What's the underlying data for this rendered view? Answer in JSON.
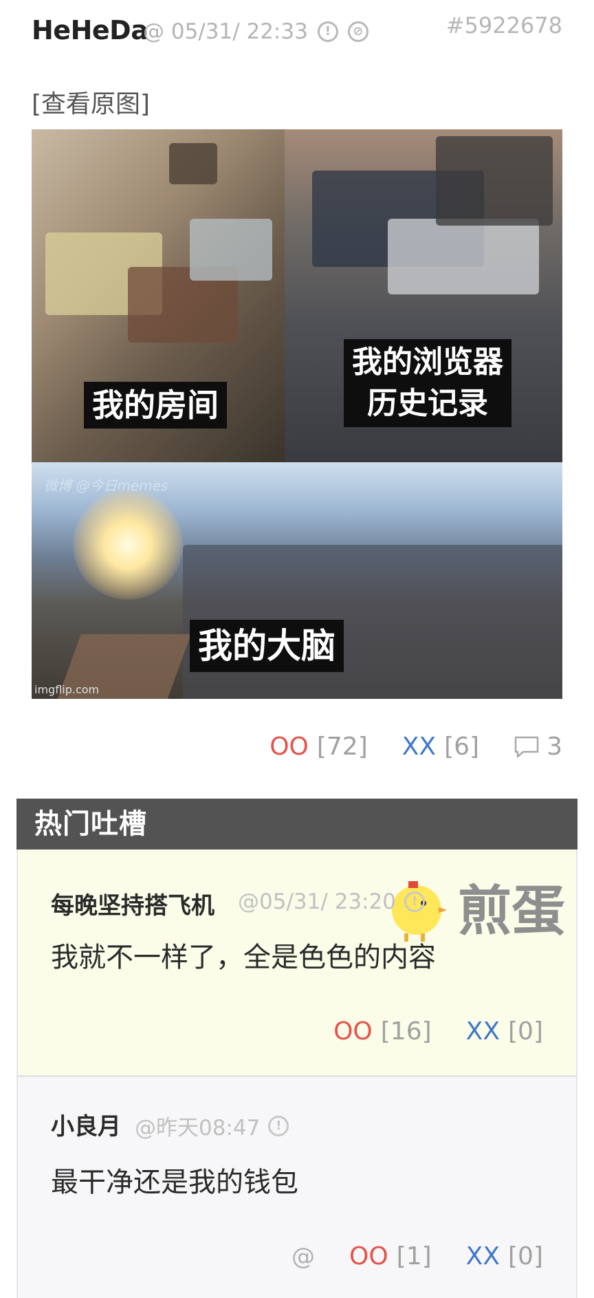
{
  "post": {
    "author": "HeHeDa",
    "meta": "@ 05/31/ 22:33",
    "id": "#5922678",
    "view_original": "[查看原图]",
    "image": {
      "captions": [
        "我的房间",
        "我的浏览器\n历史记录",
        "我的大脑"
      ],
      "watermark": "微博 @今日memes",
      "credit": "imgflip.com"
    },
    "votes": {
      "oo_label": "OO",
      "oo_count": "[72]",
      "xx_label": "XX",
      "xx_count": "[6]",
      "comments": "3"
    }
  },
  "hot_comments": {
    "title": "热门吐槽",
    "items": [
      {
        "author": "每晚坚持搭飞机",
        "meta": "@05/31/ 23:20",
        "body": "我就不一样了，全是色色的内容",
        "oo_label": "OO",
        "oo_count": "[16]",
        "xx_label": "XX",
        "xx_count": "[0]"
      },
      {
        "author": "小良月",
        "meta": "@昨天08:47",
        "body": "最干净还是我的钱包",
        "at": "@",
        "oo_label": "OO",
        "oo_count": "[1]",
        "xx_label": "XX",
        "xx_count": "[0]"
      }
    ]
  },
  "logo_text": "煎蛋",
  "colors": {
    "oo": "#e5534b",
    "xx": "#3f77c9",
    "hot_header_bg": "#535353",
    "highlight_comment_bg": "#fbfde9"
  },
  "icons": [
    "info-icon",
    "block-icon",
    "comment-icon",
    "jandan-chick-logo"
  ]
}
